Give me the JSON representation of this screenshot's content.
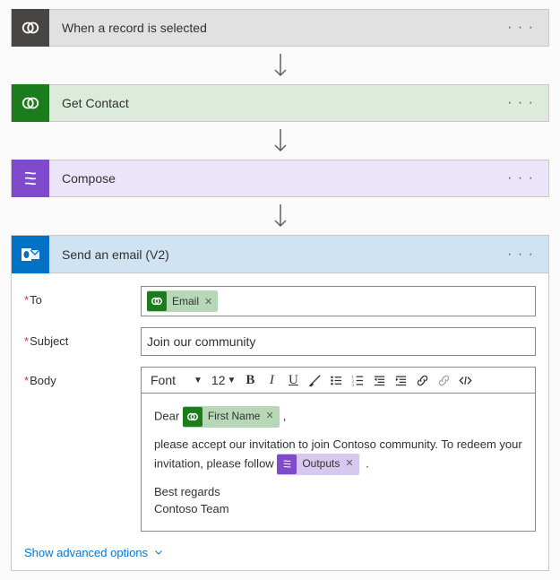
{
  "steps": {
    "trigger": {
      "title": "When a record is selected"
    },
    "getContact": {
      "title": "Get Contact"
    },
    "compose": {
      "title": "Compose"
    },
    "sendEmail": {
      "title": "Send an email (V2)"
    }
  },
  "form": {
    "to": {
      "label": "To",
      "token": {
        "text": "Email"
      }
    },
    "subject": {
      "label": "Subject",
      "value": "Join our community"
    },
    "body": {
      "label": "Body",
      "fontName": "Font",
      "fontSize": "12",
      "greeting": "Dear",
      "firstNameToken": "First Name",
      "line1pre": "please accept our invitation to join Contoso community. To redeem your",
      "line2pre": "invitation, please follow",
      "outputsToken": "Outputs",
      "line2post": ".",
      "signoff1": "Best regards",
      "signoff2": "Contoso Team"
    },
    "advanced": "Show advanced options"
  }
}
